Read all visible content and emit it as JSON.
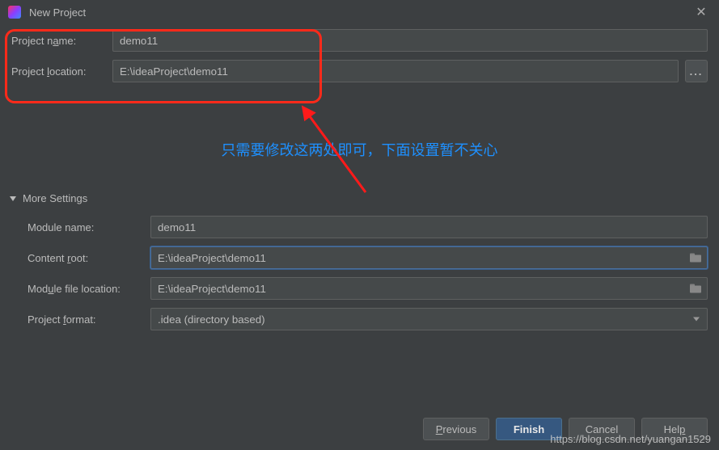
{
  "titlebar": {
    "title": "New Project"
  },
  "form": {
    "name_label_pre": "Project n",
    "name_label_u": "a",
    "name_label_post": "me:",
    "name_value": "demo11",
    "loc_label_pre": "Project ",
    "loc_label_u": "l",
    "loc_label_post": "ocation:",
    "loc_value": "E:\\ideaProject\\demo11"
  },
  "hint": "只需要修改这两处即可，下面设置暂不关心",
  "more": {
    "header": "More Settings",
    "module_name_label": "Module name:",
    "module_name_value": "demo11",
    "content_root_label_pre": "Content ",
    "content_root_label_u": "r",
    "content_root_label_post": "oot:",
    "content_root_value": "E:\\ideaProject\\demo11",
    "module_file_label_pre": "Mod",
    "module_file_label_u": "u",
    "module_file_label_post": "le file location:",
    "module_file_value": "E:\\ideaProject\\demo11",
    "format_label_pre": "Project ",
    "format_label_u": "f",
    "format_label_post": "ormat:",
    "format_value": ".idea (directory based)"
  },
  "buttons": {
    "previous_u": "P",
    "previous_rest": "revious",
    "finish": "Finish",
    "cancel": "Cancel",
    "help_pre": "Hel",
    "help_u": "p"
  },
  "watermark": "https://blog.csdn.net/yuangan1529"
}
